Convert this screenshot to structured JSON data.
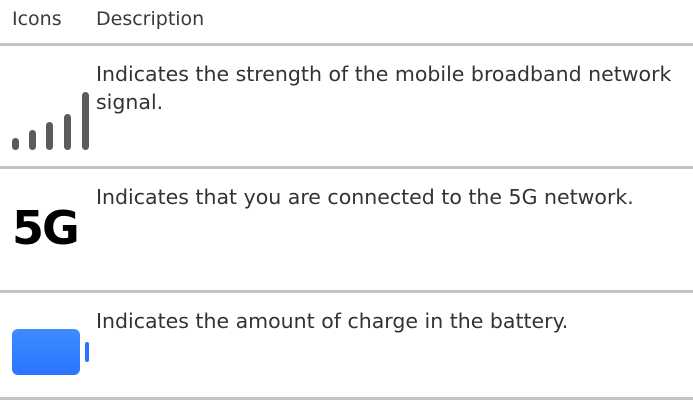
{
  "table": {
    "headers": {
      "icons": "Icons",
      "description": "Description"
    },
    "rows": [
      {
        "icon": "signal-strength-icon",
        "description": "Indicates the strength of the mobile broadband network signal."
      },
      {
        "icon": "5g-icon",
        "icon_text": "5G",
        "description": "Indicates that you are connected to the 5G network."
      },
      {
        "icon": "battery-icon",
        "description": "Indicates the amount of charge in the battery."
      }
    ]
  },
  "colors": {
    "signal": "#5a5a5f",
    "battery": "#2a75ff",
    "divider": "#c4c4c4"
  }
}
